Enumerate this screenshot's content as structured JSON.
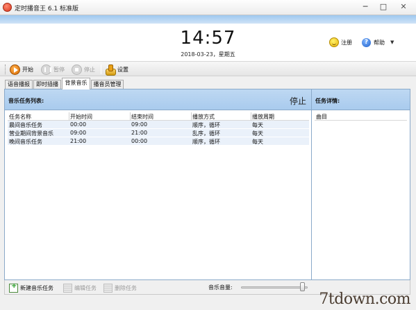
{
  "window": {
    "title": "定时播音王 6.1 标准版",
    "min_glyph": "─",
    "max_glyph": "□",
    "close_glyph": "✕"
  },
  "header": {
    "time": "14:57",
    "date": "2018-03-23，星期五",
    "register_label": "注册",
    "help_label": "帮助",
    "help_glyph": "?",
    "menu_caret": "▼"
  },
  "toolbar": {
    "start_label": "开始",
    "pause_label": "暂停",
    "stop_label": "停止",
    "settings_label": "设置"
  },
  "tabs": [
    {
      "label": "语音播报",
      "active": false
    },
    {
      "label": "即时插播",
      "active": false
    },
    {
      "label": "背景音乐",
      "active": true
    },
    {
      "label": "播音员管理",
      "active": false
    }
  ],
  "task_list": {
    "title": "音乐任务列表:",
    "status": "停止",
    "columns": [
      "任务名称",
      "开始时间",
      "结束时间",
      "播放方式",
      "播放周期"
    ],
    "rows": [
      [
        "晨间音乐任务",
        "00:00",
        "09:00",
        "顺序，循环",
        "每天"
      ],
      [
        "营业期间背景音乐",
        "09:00",
        "21:00",
        "乱序，循环",
        "每天"
      ],
      [
        "晚间音乐任务",
        "21:00",
        "00:00",
        "顺序，循环",
        "每天"
      ]
    ]
  },
  "task_detail": {
    "title": "任务详情:",
    "column": "曲目"
  },
  "bottom": {
    "new_label": "新建音乐任务",
    "edit_label": "编辑任务",
    "delete_label": "删除任务",
    "volume_label": "音乐音量:",
    "volume_level": 0.95
  },
  "watermark": "7tdown.com",
  "colors": {
    "panel_header": "#b4d1f0",
    "row_highlight": "#eaf1fa",
    "accent_blue": "#9ec8ef"
  }
}
